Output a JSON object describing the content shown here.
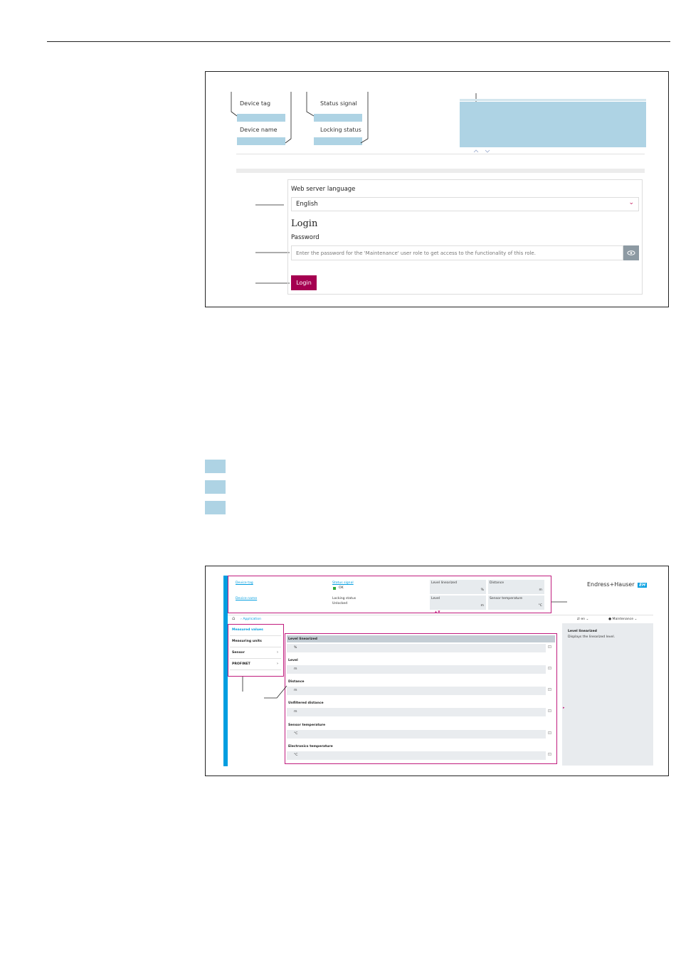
{
  "figure1": {
    "labels": {
      "device_tag": "Device tag",
      "device_name": "Device name",
      "status_signal": "Status signal",
      "locking_status": "Locking status"
    },
    "language_label": "Web server language",
    "language_value": "English",
    "login_heading": "Login",
    "password_label": "Password",
    "password_placeholder": "Enter the password for the 'Maintenance' user role to get access to the functionality of this role.",
    "login_button": "Login"
  },
  "figure2": {
    "header": {
      "device_tag": "Device tag",
      "device_name": "Device name",
      "status_signal": "Status signal",
      "status_value": "OK",
      "locking_status": "Locking status",
      "locking_value": "Unlocked",
      "tiles": [
        {
          "label": "Level linearized",
          "unit": "%"
        },
        {
          "label": "Distance",
          "unit": "m"
        },
        {
          "label": "Level",
          "unit": "m"
        },
        {
          "label": "Sensor temperature",
          "unit": "°C"
        }
      ]
    },
    "logo_text": "Endress+Hauser",
    "logo_mark": "EH",
    "breadcrumb": "Application",
    "language": "en",
    "user_role": "Maintenance",
    "nav": [
      {
        "label": "Measured values",
        "active": true
      },
      {
        "label": "Measuring units",
        "active": false
      },
      {
        "label": "Sensor",
        "active": false
      },
      {
        "label": "PROFINET",
        "active": false
      }
    ],
    "fields": [
      {
        "label": "Level linearized",
        "unit": "%"
      },
      {
        "label": "Level",
        "unit": "m"
      },
      {
        "label": "Distance",
        "unit": "m"
      },
      {
        "label": "Unfiltered distance",
        "unit": "m"
      },
      {
        "label": "Sensor temperature",
        "unit": "°C"
      },
      {
        "label": "Electronics temperature",
        "unit": "°C"
      }
    ],
    "help_title": "Level linearized",
    "help_text": "Displays the linearized level.",
    "accent_colors": {
      "magenta": "#c01c7e",
      "blue": "#009ee0",
      "login": "#a50050",
      "ok": "#2eaa3a"
    }
  }
}
